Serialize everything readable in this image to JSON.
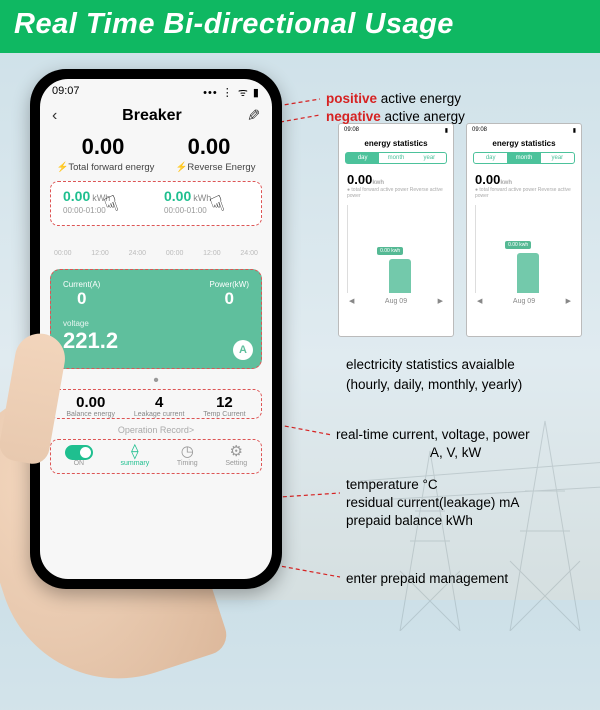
{
  "banner": "Real Time Bi-directional Usage",
  "phone": {
    "time": "09:07",
    "title": "Breaker",
    "positive_value": "0.00",
    "negative_value": "0.00",
    "forward_label": "Total forward energy",
    "reverse_label": "Reverse Energy",
    "energy": {
      "fwd_val": "0.00",
      "fwd_unit": "kWh",
      "fwd_time": "00:00-01:00",
      "rev_val": "0.00",
      "rev_unit": "kWh",
      "rev_time": "00:00-01:00"
    },
    "ticks": [
      "00:00",
      "12:00",
      "24:00",
      "00:00",
      "12:00",
      "24:00"
    ],
    "card": {
      "current_lbl": "Current(A)",
      "current_val": "0",
      "power_lbl": "Power(kW)",
      "power_val": "0",
      "volt_lbl": "voltage",
      "volt_val": "221.2",
      "badge": "A"
    },
    "bottom": {
      "b1_val": "0.00",
      "b1_lbl": "Balance energy",
      "b2_val": "4",
      "b2_lbl": "Leakage current",
      "b3_val": "12",
      "b3_lbl": "Temp Current"
    },
    "op_record": "Operation Record>",
    "nav": {
      "on": "ON",
      "summary": "summary",
      "timing": "Timing",
      "setting": "Setting"
    }
  },
  "mini": {
    "time": "09:08",
    "title": "energy statistics",
    "tabs": {
      "day": "day",
      "month": "month",
      "year": "year"
    },
    "val": "0.00",
    "unit": "kwh",
    "sub": "● total forward active power     Reverse active power",
    "bar_label": "0.00 kwh",
    "date": "Aug 09",
    "bar1_h": 34,
    "bar2_h": 40
  },
  "annotations": {
    "positive": "positive",
    "positive_rest": " active energy",
    "negative": "negative",
    "negative_rest": " active anergy",
    "stats": "electricity statistics avaialble\n(hourly, daily, monthly, yearly)",
    "rt1": "real-time current, voltage, power",
    "rt2": "A, V, kW",
    "t1": "temperature °C",
    "t2": "residual current(leakage) mA",
    "t3": "prepaid balance kWh",
    "prepaid": "enter prepaid management"
  }
}
